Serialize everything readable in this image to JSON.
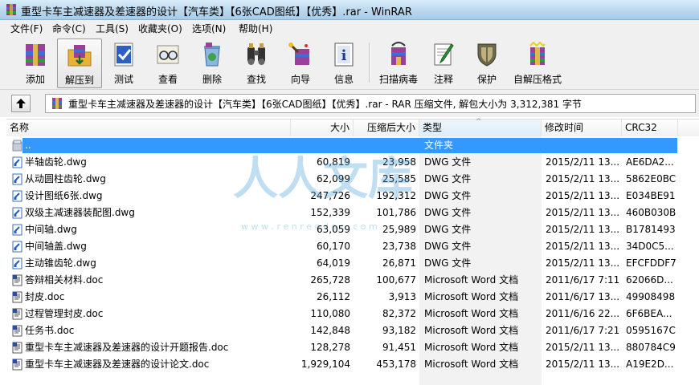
{
  "window": {
    "title": "重型卡车主减速器及差速器的设计【汽车类】【6张CAD图纸】【优秀】.rar - WinRAR"
  },
  "menu": [
    "文件(F)",
    "命令(C)",
    "工具(S)",
    "收藏夹(O)",
    "选项(N)",
    "帮助(H)"
  ],
  "toolbar": {
    "add": "添加",
    "extract": "解压到",
    "test": "测试",
    "view": "查看",
    "delete": "删除",
    "find": "查找",
    "wizard": "向导",
    "info": "信息",
    "scan": "扫描病毒",
    "comment": "注释",
    "protect": "保护",
    "sfx": "自解压格式"
  },
  "address": {
    "text": "重型卡车主减速器及差速器的设计【汽车类】【6张CAD图纸】【优秀】.rar - RAR 压缩文件, 解包大小为 3,312,381 字节"
  },
  "columns": {
    "name": "名称",
    "size": "大小",
    "packed": "压缩后大小",
    "type": "类型",
    "modified": "修改时间",
    "crc": "CRC32"
  },
  "watermark": {
    "text": "人人文库",
    "url": "w w w . r e n r e n d o c . c o m"
  },
  "files": [
    {
      "name": "..",
      "size": "",
      "packed": "",
      "type": "文件夹",
      "modified": "",
      "crc": "",
      "icon": "folder-icon",
      "selected": true
    },
    {
      "name": "半轴齿轮.dwg",
      "size": "60,819",
      "packed": "23,958",
      "type": "DWG 文件",
      "modified": "2015/2/11 13...",
      "crc": "AE6DA2...",
      "icon": "dwg-file-icon"
    },
    {
      "name": "从动圆柱齿轮.dwg",
      "size": "62,099",
      "packed": "25,585",
      "type": "DWG 文件",
      "modified": "2015/2/11 13...",
      "crc": "5862E0BC",
      "icon": "dwg-file-icon"
    },
    {
      "name": "设计图纸6张.dwg",
      "size": "247,726",
      "packed": "192,312",
      "type": "DWG 文件",
      "modified": "2015/2/11 13...",
      "crc": "E034BE91",
      "icon": "dwg-file-icon"
    },
    {
      "name": "双级主减速器装配图.dwg",
      "size": "152,339",
      "packed": "101,786",
      "type": "DWG 文件",
      "modified": "2015/2/11 13...",
      "crc": "460B030B",
      "icon": "dwg-file-icon"
    },
    {
      "name": "中间轴.dwg",
      "size": "63,059",
      "packed": "25,989",
      "type": "DWG 文件",
      "modified": "2015/2/11 13...",
      "crc": "B1781493",
      "icon": "dwg-file-icon"
    },
    {
      "name": "中间轴盖.dwg",
      "size": "60,170",
      "packed": "23,738",
      "type": "DWG 文件",
      "modified": "2015/2/11 13...",
      "crc": "34D0C5...",
      "icon": "dwg-file-icon"
    },
    {
      "name": "主动锥齿轮.dwg",
      "size": "64,019",
      "packed": "26,871",
      "type": "DWG 文件",
      "modified": "2015/2/11 13...",
      "crc": "EFCFDDF7",
      "icon": "dwg-file-icon"
    },
    {
      "name": "答辩相关材料.doc",
      "size": "265,728",
      "packed": "100,677",
      "type": "Microsoft Word 文档",
      "modified": "2011/6/17 7:11",
      "crc": "62066D...",
      "icon": "doc-file-icon"
    },
    {
      "name": "封皮.doc",
      "size": "26,112",
      "packed": "3,913",
      "type": "Microsoft Word 文档",
      "modified": "2011/6/17 13...",
      "crc": "49908498",
      "icon": "doc-file-icon"
    },
    {
      "name": "过程管理封皮.doc",
      "size": "110,080",
      "packed": "82,372",
      "type": "Microsoft Word 文档",
      "modified": "2011/6/16 22...",
      "crc": "6F6BEA...",
      "icon": "doc-file-icon"
    },
    {
      "name": "任务书.doc",
      "size": "142,848",
      "packed": "93,182",
      "type": "Microsoft Word 文档",
      "modified": "2011/6/17 7:21",
      "crc": "0595167C",
      "icon": "doc-file-icon"
    },
    {
      "name": "重型卡车主减速器及差速器的设计开题报告.doc",
      "size": "128,278",
      "packed": "91,451",
      "type": "Microsoft Word 文档",
      "modified": "2015/2/11 13...",
      "crc": "880784C9",
      "icon": "doc-file-icon"
    },
    {
      "name": "重型卡车主减速器及差速器的设计论文.doc",
      "size": "1,929,104",
      "packed": "453,178",
      "type": "Microsoft Word 文档",
      "modified": "2015/2/11 13...",
      "crc": "A19E2D...",
      "icon": "doc-file-icon"
    }
  ]
}
